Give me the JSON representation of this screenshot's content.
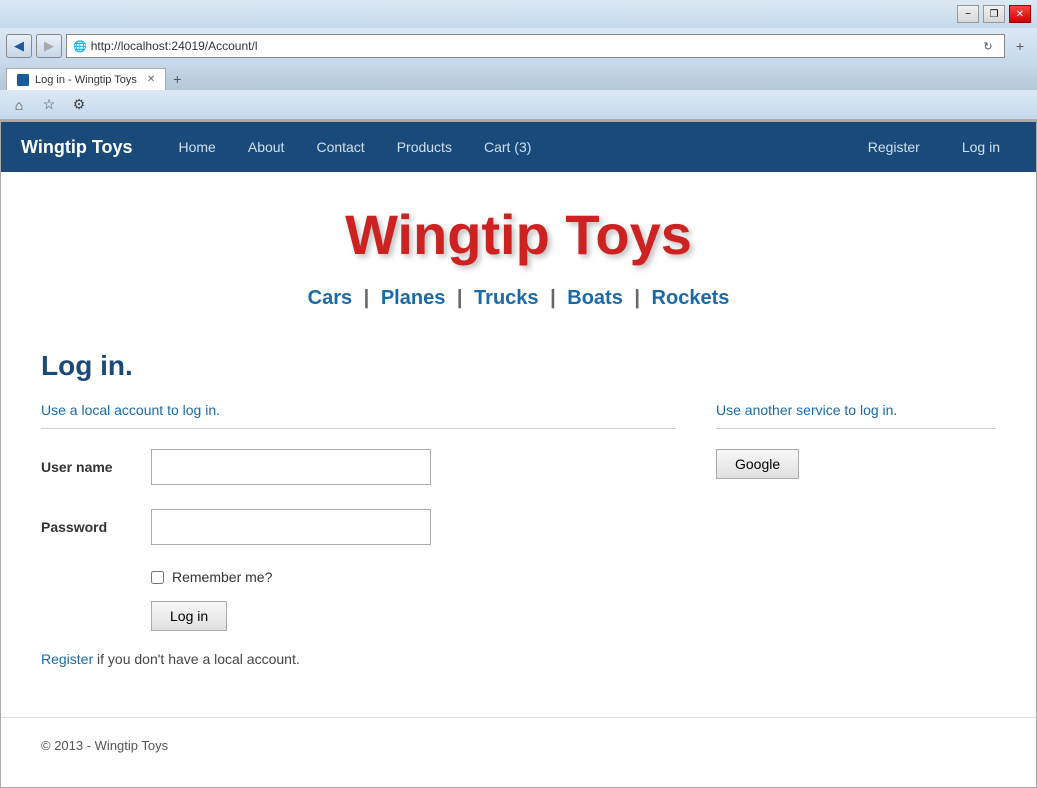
{
  "browser": {
    "url": "http://localhost:24019/Account/l",
    "tab_title": "Log in - Wingtip Toys",
    "tab_favicon_color": "#1a5a9a",
    "minimize_label": "−",
    "restore_label": "❐",
    "close_label": "✕",
    "back_label": "◀",
    "forward_label": "▶",
    "home_icon": "⌂",
    "star_icon": "☆",
    "gear_icon": "⚙"
  },
  "site": {
    "logo": "Wingtip Toys",
    "nav": {
      "home": "Home",
      "about": "About",
      "contact": "Contact",
      "products": "Products",
      "cart": "Cart (3)",
      "register": "Register",
      "login": "Log in"
    },
    "hero_title": "Wingtip Toys",
    "categories": [
      {
        "label": "Cars",
        "sep": " | "
      },
      {
        "label": "Planes",
        "sep": " | "
      },
      {
        "label": "Trucks",
        "sep": " | "
      },
      {
        "label": "Boats",
        "sep": " | "
      },
      {
        "label": "Rockets",
        "sep": ""
      }
    ]
  },
  "login_page": {
    "page_title": "Log in.",
    "local_section_label": "Use a local account to log in.",
    "external_section_label": "Use another service to log in.",
    "username_label": "User name",
    "password_label": "Password",
    "remember_label": "Remember me?",
    "login_button": "Log in",
    "register_note": " if you don't have a local account.",
    "register_link_label": "Register",
    "google_button": "Google"
  },
  "footer": {
    "copyright": "© 2013 - Wingtip Toys"
  }
}
